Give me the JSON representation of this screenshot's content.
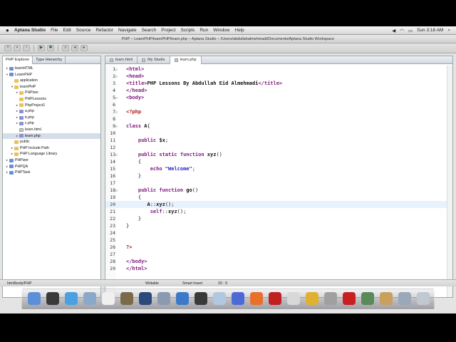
{
  "menubar": {
    "apple": "",
    "app_name": "Aptana Studio",
    "menus": [
      "File",
      "Edit",
      "Source",
      "Refactor",
      "Navigate",
      "Search",
      "Project",
      "Scripts",
      "Run",
      "Window",
      "Help"
    ],
    "clock": "Sun 3:18 AM"
  },
  "window_title": "PHP – LearnPHP/learnPHP/learn.php – Aptana Studio – /Users/abdullahalmehmadi/Documents/Aptana Studio Workspace",
  "explorer": {
    "tabs": [
      "PHP Explorer",
      "Type Hierarchy"
    ],
    "items": [
      {
        "label": "learnHTML",
        "indent": 0,
        "twisty": "closed",
        "icon": "proj"
      },
      {
        "label": "LearnPHP",
        "indent": 0,
        "twisty": "open",
        "icon": "proj"
      },
      {
        "label": "application",
        "indent": 1,
        "twisty": "",
        "icon": "folder"
      },
      {
        "label": "learnPHP",
        "indent": 1,
        "twisty": "open",
        "icon": "folder"
      },
      {
        "label": "PHPizer",
        "indent": 2,
        "twisty": "closed",
        "icon": "folder"
      },
      {
        "label": "PHPLessons",
        "indent": 2,
        "twisty": "",
        "icon": "folder"
      },
      {
        "label": "PhpProject1",
        "indent": 2,
        "twisty": "closed",
        "icon": "folder"
      },
      {
        "label": "a.php",
        "indent": 2,
        "twisty": "closed",
        "icon": "php"
      },
      {
        "label": "b.php",
        "indent": 2,
        "twisty": "closed",
        "icon": "php"
      },
      {
        "label": "c.php",
        "indent": 2,
        "twisty": "closed",
        "icon": "php"
      },
      {
        "label": "learn.html",
        "indent": 2,
        "twisty": "",
        "icon": "html"
      },
      {
        "label": "learn.php",
        "indent": 2,
        "twisty": "closed",
        "icon": "php",
        "selected": true
      },
      {
        "label": "public",
        "indent": 1,
        "twisty": "",
        "icon": "folder"
      },
      {
        "label": "PHP Include Path",
        "indent": 1,
        "twisty": "closed",
        "icon": "folder"
      },
      {
        "label": "PHP Language Library",
        "indent": 1,
        "twisty": "closed",
        "icon": "folder"
      },
      {
        "label": "PHPizer",
        "indent": 0,
        "twisty": "closed",
        "icon": "proj"
      },
      {
        "label": "PHPQA",
        "indent": 0,
        "twisty": "closed",
        "icon": "proj"
      },
      {
        "label": "PHPTask",
        "indent": 0,
        "twisty": "closed",
        "icon": "proj"
      }
    ]
  },
  "editor": {
    "tabs": [
      {
        "label": "learn.html",
        "active": false
      },
      {
        "label": "My Studio",
        "active": false
      },
      {
        "label": "learn.php",
        "active": true
      }
    ],
    "current_line": 20,
    "lines": [
      {
        "n": "1",
        "fold": "⊟",
        "parts": [
          [
            "c-tag",
            "<html>"
          ]
        ]
      },
      {
        "n": "2",
        "fold": "⊟",
        "parts": [
          [
            "c-tag",
            "<head>"
          ]
        ]
      },
      {
        "n": "3",
        "fold": "",
        "parts": [
          [
            "c-tag",
            "<title>"
          ],
          [
            "c-plain",
            "PHP Lessons By Abdullah Eid Almehmadi"
          ],
          [
            "c-tag",
            "</title>"
          ]
        ]
      },
      {
        "n": "4",
        "fold": "",
        "parts": [
          [
            "c-tag",
            "</head>"
          ]
        ]
      },
      {
        "n": "5",
        "fold": "⊟",
        "parts": [
          [
            "c-tag",
            "<body>"
          ]
        ]
      },
      {
        "n": "6",
        "fold": "",
        "parts": []
      },
      {
        "n": "7",
        "fold": "⊟",
        "parts": [
          [
            "c-php",
            "<?php"
          ]
        ]
      },
      {
        "n": "8",
        "fold": "",
        "parts": []
      },
      {
        "n": "9",
        "fold": "⊟",
        "parts": [
          [
            "c-kw",
            "class "
          ],
          [
            "c-plain",
            "A"
          ],
          [
            "c-norm",
            "{"
          ]
        ]
      },
      {
        "n": "10",
        "fold": "",
        "parts": []
      },
      {
        "n": "11",
        "fold": "",
        "parts": [
          [
            "c-norm",
            "    "
          ],
          [
            "c-kw",
            "public "
          ],
          [
            "c-plain",
            "$x"
          ],
          [
            "c-norm",
            ";"
          ]
        ]
      },
      {
        "n": "12",
        "fold": "",
        "parts": []
      },
      {
        "n": "13",
        "fold": "⊟",
        "parts": [
          [
            "c-norm",
            "    "
          ],
          [
            "c-kw",
            "public static function "
          ],
          [
            "c-plain",
            "xyz"
          ],
          [
            "c-norm",
            "()"
          ]
        ]
      },
      {
        "n": "14",
        "fold": "",
        "parts": [
          [
            "c-norm",
            "    {"
          ]
        ]
      },
      {
        "n": "15",
        "fold": "",
        "parts": [
          [
            "c-norm",
            "        "
          ],
          [
            "c-kw",
            "echo "
          ],
          [
            "c-str",
            "\"Welcome\""
          ],
          [
            "c-norm",
            ";"
          ]
        ]
      },
      {
        "n": "16",
        "fold": "",
        "parts": [
          [
            "c-norm",
            "    }"
          ]
        ]
      },
      {
        "n": "17",
        "fold": "",
        "parts": []
      },
      {
        "n": "18",
        "fold": "⊟",
        "parts": [
          [
            "c-norm",
            "    "
          ],
          [
            "c-kw",
            "public function "
          ],
          [
            "c-plain",
            "go"
          ],
          [
            "c-norm",
            "()"
          ]
        ]
      },
      {
        "n": "19",
        "fold": "",
        "parts": [
          [
            "c-norm",
            "    {"
          ]
        ]
      },
      {
        "n": "20",
        "fold": "",
        "parts": [
          [
            "c-norm",
            "       "
          ],
          [
            "c-plain",
            "A"
          ],
          [
            "c-norm",
            "::"
          ],
          [
            "c-plain",
            "xyz"
          ],
          [
            "c-norm",
            "();"
          ]
        ]
      },
      {
        "n": "21",
        "fold": "",
        "parts": [
          [
            "c-norm",
            "        "
          ],
          [
            "c-kw",
            "self"
          ],
          [
            "c-norm",
            "::"
          ],
          [
            "c-plain",
            "xyz"
          ],
          [
            "c-norm",
            "();"
          ]
        ]
      },
      {
        "n": "22",
        "fold": "",
        "parts": [
          [
            "c-norm",
            "    }"
          ]
        ]
      },
      {
        "n": "23",
        "fold": "",
        "parts": [
          [
            "c-norm",
            "}"
          ]
        ]
      },
      {
        "n": "24",
        "fold": "",
        "parts": []
      },
      {
        "n": "25",
        "fold": "",
        "parts": []
      },
      {
        "n": "26",
        "fold": "",
        "parts": [
          [
            "c-php",
            "?>"
          ]
        ]
      },
      {
        "n": "27",
        "fold": "",
        "parts": []
      },
      {
        "n": "28",
        "fold": "",
        "parts": [
          [
            "c-tag",
            "</body>"
          ]
        ]
      },
      {
        "n": "29",
        "fold": "",
        "parts": [
          [
            "c-tag",
            "</html>"
          ]
        ]
      }
    ]
  },
  "statusbar": {
    "path": "html/body/PHP",
    "mode": "Writable",
    "insert": "Smart Insert",
    "position": "20 : 9"
  },
  "dock": {
    "icons": [
      "finder-icon",
      "dashboard-icon",
      "safari-icon",
      "mail-icon",
      "calendar-icon",
      "photo-icon",
      "chess-icon",
      "utilities-icon",
      "itunes-icon",
      "aptana-icon",
      "preview-icon",
      "bluetooth-icon",
      "firefox-icon",
      "facetime-icon",
      "keychain-icon",
      "chrome-icon",
      "script-icon",
      "filezilla-icon",
      "app-icon",
      "folder-icon",
      "documents-icon",
      "trash-icon"
    ]
  }
}
